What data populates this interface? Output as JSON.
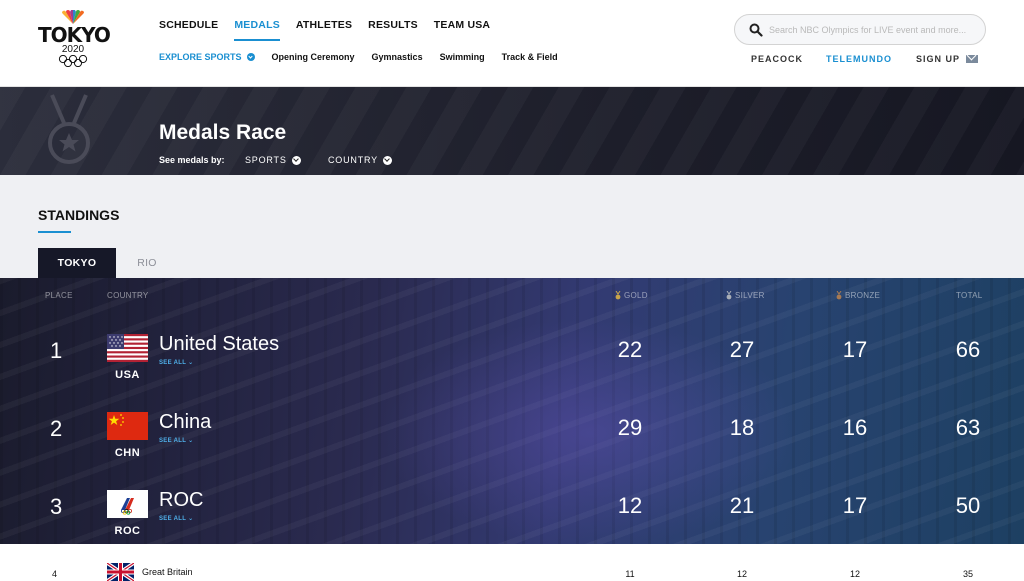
{
  "header": {
    "logo": {
      "word": "TOKYO",
      "year": "2020"
    },
    "nav": [
      {
        "label": "SCHEDULE",
        "active": false
      },
      {
        "label": "MEDALS",
        "active": true
      },
      {
        "label": "ATHLETES",
        "active": false
      },
      {
        "label": "RESULTS",
        "active": false
      },
      {
        "label": "TEAM USA",
        "active": false
      }
    ],
    "subnav": {
      "explore": "EXPLORE SPORTS",
      "links": [
        "Opening Ceremony",
        "Gymnastics",
        "Swimming",
        "Track & Field"
      ]
    },
    "search": {
      "placeholder": "Search NBC Olympics for LIVE event and more...",
      "value": ""
    },
    "utility": {
      "peacock": "PEACOCK",
      "telemundo": "TELEMUNDO",
      "signup": "SIGN UP"
    }
  },
  "hero": {
    "title": "Medals Race",
    "see_by": "See medals by:",
    "filters": [
      "SPORTS",
      "COUNTRY"
    ]
  },
  "standings": {
    "heading": "STANDINGS",
    "tabs": [
      {
        "label": "TOKYO",
        "active": true
      },
      {
        "label": "RIO",
        "active": false
      }
    ],
    "columns": {
      "place": "PLACE",
      "country": "COUNTRY",
      "gold": "GOLD",
      "silver": "SILVER",
      "bronze": "BRONZE",
      "total": "TOTAL"
    },
    "see_all": "SEE ALL",
    "rows": [
      {
        "place": "1",
        "name": "United States",
        "code": "USA",
        "gold": "22",
        "silver": "27",
        "bronze": "17",
        "total": "66"
      },
      {
        "place": "2",
        "name": "China",
        "code": "CHN",
        "gold": "29",
        "silver": "18",
        "bronze": "16",
        "total": "63"
      },
      {
        "place": "3",
        "name": "ROC",
        "code": "ROC",
        "gold": "12",
        "silver": "21",
        "bronze": "17",
        "total": "50"
      },
      {
        "place": "4",
        "name": "Great Britain",
        "gold": "11",
        "silver": "12",
        "bronze": "12",
        "total": "35"
      }
    ]
  },
  "colors": {
    "accent": "#1a8fd1",
    "gold": "#c9a44a",
    "silver": "#a9aeb6",
    "bronze": "#a87a52"
  }
}
